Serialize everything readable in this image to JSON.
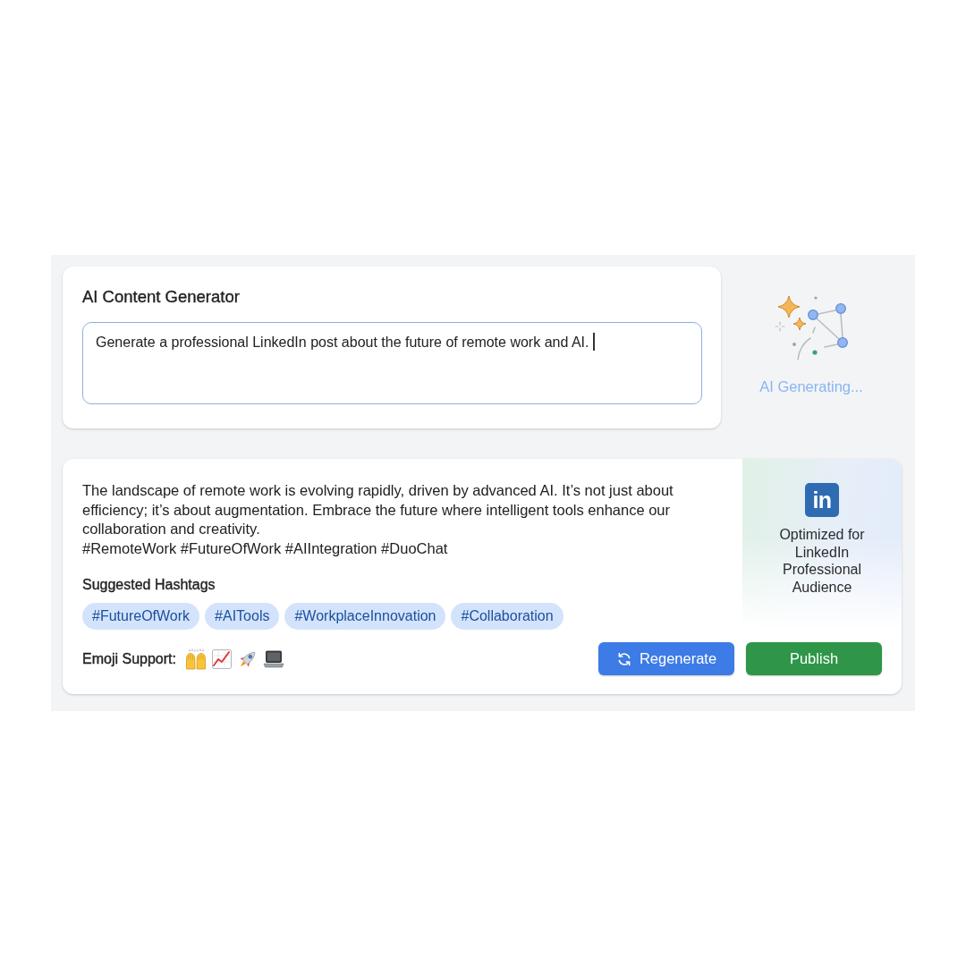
{
  "generator": {
    "title": "AI Content Generator",
    "prompt": {
      "value": "Generate a professional LinkedIn post about the future of remote work and AI.",
      "focused": true
    }
  },
  "status": {
    "label": "AI Generating..."
  },
  "output": {
    "text": "The landscape of remote work is evolving rapidly, driven by advanced AI. It’s not just about efficiency; it’s about augmentation. Embrace the future where intelligent tools enhance our collaboration and creativity.",
    "hashtag_line": "#RemoteWork #FutureOfWork #AIIntegration #DuoChat",
    "suggested_hashtags": {
      "heading": "Suggested Hashtags",
      "tags": [
        "#FutureOfWork",
        "#AITools",
        "#WorkplaceInnovation",
        "#Collaboration"
      ]
    },
    "emoji_support": {
      "label": "Emoji Support:"
    },
    "buttons": [
      {
        "label": "Regenerate",
        "kind": "regenerate"
      },
      {
        "label": "Publish",
        "kind": "publish"
      }
    ]
  },
  "platform": {
    "logo": "in",
    "label": "Optimized for LinkedIn Professional Audience"
  }
}
